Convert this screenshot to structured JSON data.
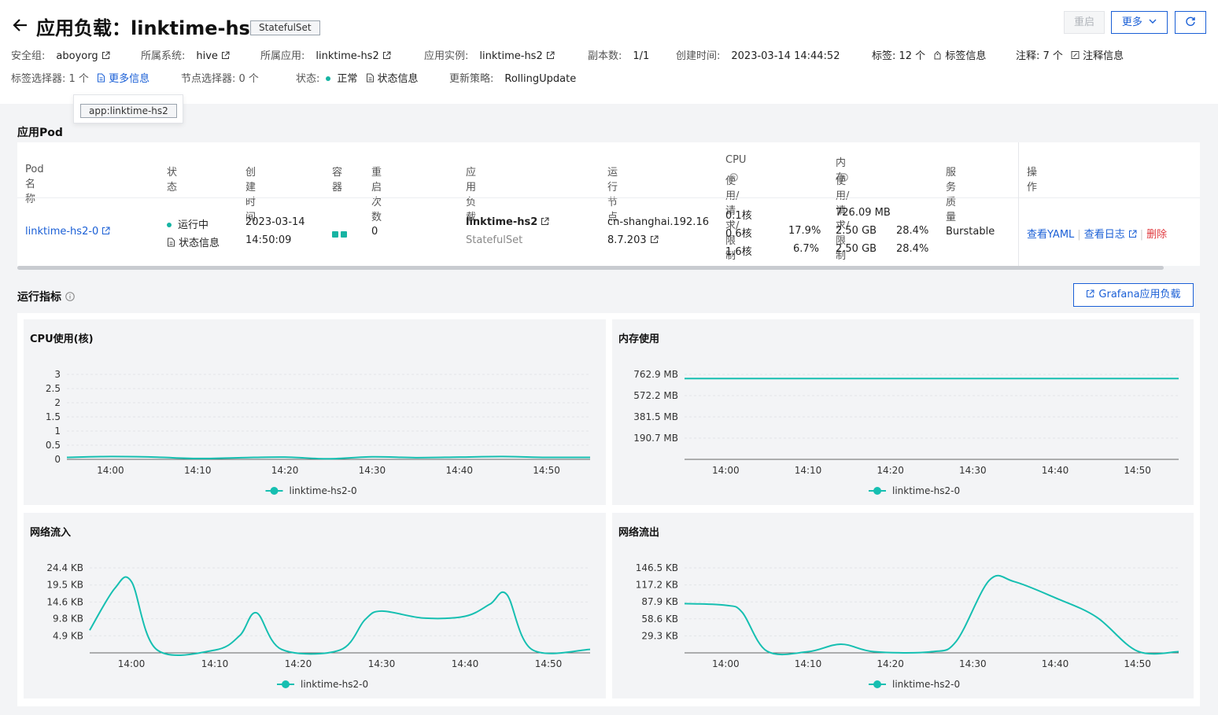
{
  "header": {
    "title": "应用负载：linktime-hs2",
    "kind_badge": "StatefulSet",
    "restart_label": "重启",
    "more_label": "更多",
    "meta_row1": [
      {
        "label": "安全组:",
        "value": "aboyorg",
        "ext": true
      },
      {
        "label": "所属系统:",
        "value": "hive",
        "ext": true
      },
      {
        "label": "所属应用:",
        "value": "linktime-hs2",
        "ext": true
      },
      {
        "label": "应用实例:",
        "value": "linktime-hs2",
        "ext": true
      },
      {
        "label": "副本数:",
        "value": "1/1"
      },
      {
        "label": "创建时间:",
        "value": "2023-03-14 14:44:52"
      }
    ],
    "labels_text": "标签: 12 个",
    "labels_link": "标签信息",
    "annotations_text": "注释: 7 个",
    "annotations_link": "注释信息",
    "selector_text": "标签选择器: 1 个",
    "selector_link": "更多信息",
    "node_selector": "节点选择器: 0 个",
    "status_label": "状态:",
    "status_value": "正常",
    "status_link": "状态信息",
    "strategy_label": "更新策略:",
    "strategy_value": "RollingUpdate",
    "tooltip_tag": "app:linktime-hs2"
  },
  "pods": {
    "section_title": "应用Pod",
    "columns": [
      "Pod名称",
      "状态",
      "创建时间",
      "容器",
      "重启次数",
      "应用负载",
      "运行节点",
      "CPU",
      "使用/请求/限制",
      "内存",
      "使用/请求/限制",
      "服务质量",
      "操作"
    ],
    "row": {
      "name": "linktime-hs2-0",
      "status": "运行中",
      "status_link": "状态信息",
      "created_date": "2023-03-14",
      "created_time": "14:50:09",
      "restarts": "0",
      "workload": "linktime-hs2",
      "workload_kind": "StatefulSet",
      "node_line1": "cn-shanghai.192.16",
      "node_line2": "8.7.203",
      "cpu_use": "0.1核",
      "cpu_req": "0.6核",
      "cpu_req_pct": "17.9%",
      "cpu_lim": "1.6核",
      "cpu_lim_pct": "6.7%",
      "mem_use": "726.09 MB",
      "mem_req": "2.50 GB",
      "mem_req_pct": "28.4%",
      "mem_lim": "2.50 GB",
      "mem_lim_pct": "28.4%",
      "qos": "Burstable",
      "op_yaml": "查看YAML",
      "op_logs": "查看日志",
      "op_delete": "删除"
    }
  },
  "metrics": {
    "section_title": "运行指标",
    "grafana_label": "Grafana应用负载",
    "series_color": "#16bfb1"
  },
  "chart_data": [
    {
      "type": "line",
      "title": "CPU使用(核)",
      "x": [
        "13:55",
        "14:00",
        "14:05",
        "14:10",
        "14:15",
        "14:20",
        "14:25",
        "14:30",
        "14:35",
        "14:40",
        "14:45",
        "14:50",
        "14:55"
      ],
      "xticks": [
        "14:00",
        "14:10",
        "14:20",
        "14:30",
        "14:40",
        "14:50"
      ],
      "yticks": [
        "0",
        "0.5",
        "1",
        "1.5",
        "2",
        "2.5",
        "3"
      ],
      "ylim": [
        0,
        3
      ],
      "series": [
        {
          "name": "linktime-hs2-0",
          "values": [
            0.07,
            0.1,
            0.08,
            0.03,
            0.06,
            0.08,
            0.02,
            0.09,
            0.06,
            0.08,
            0.1,
            0.07,
            0.07
          ]
        }
      ]
    },
    {
      "type": "line",
      "title": "内存使用",
      "x": [
        "13:55",
        "14:00",
        "14:05",
        "14:10",
        "14:15",
        "14:20",
        "14:25",
        "14:30",
        "14:35",
        "14:40",
        "14:45",
        "14:50",
        "14:55"
      ],
      "xticks": [
        "14:00",
        "14:10",
        "14:20",
        "14:30",
        "14:40",
        "14:50"
      ],
      "yticks": [
        "190.7 MB",
        "381.5 MB",
        "572.2 MB",
        "762.9 MB"
      ],
      "ylim": [
        0,
        762.9
      ],
      "series": [
        {
          "name": "linktime-hs2-0",
          "values": [
            726,
            726,
            726,
            726,
            726,
            726,
            726,
            726,
            726,
            726,
            726,
            726,
            726
          ]
        }
      ]
    },
    {
      "type": "line",
      "title": "网络流入",
      "x": [
        "13:55",
        "13:58",
        "14:00",
        "14:03",
        "14:10",
        "14:13",
        "14:15",
        "14:18",
        "14:25",
        "14:28",
        "14:30",
        "14:35",
        "14:40",
        "14:43",
        "14:45",
        "14:48",
        "14:55"
      ],
      "xticks": [
        "14:00",
        "14:10",
        "14:20",
        "14:30",
        "14:40",
        "14:50"
      ],
      "yticks": [
        "4.9 KB",
        "9.8 KB",
        "14.6 KB",
        "19.5 KB",
        "24.4 KB"
      ],
      "ylim": [
        0,
        24.4
      ],
      "series": [
        {
          "name": "linktime-hs2-0",
          "values": [
            6.5,
            18.5,
            20.5,
            1.0,
            0.8,
            5.0,
            11.5,
            1.0,
            0.8,
            9.5,
            12.0,
            10.0,
            10.5,
            14.0,
            16.8,
            1.0,
            1.0
          ]
        }
      ]
    },
    {
      "type": "line",
      "title": "网络流出",
      "x": [
        "13:55",
        "14:00",
        "14:02",
        "14:05",
        "14:10",
        "14:14",
        "14:18",
        "14:25",
        "14:28",
        "14:32",
        "14:35",
        "14:40",
        "14:45",
        "14:50",
        "14:55"
      ],
      "xticks": [
        "14:00",
        "14:10",
        "14:20",
        "14:30",
        "14:40",
        "14:50"
      ],
      "yticks": [
        "29.3 KB",
        "58.6 KB",
        "87.9 KB",
        "117.2 KB",
        "146.5 KB"
      ],
      "ylim": [
        0,
        146.5
      ],
      "series": [
        {
          "name": "linktime-hs2-0",
          "values": [
            85,
            82,
            70,
            3,
            2,
            15,
            2,
            2,
            20,
            125,
            123,
            95,
            62,
            3,
            2
          ]
        }
      ]
    }
  ]
}
